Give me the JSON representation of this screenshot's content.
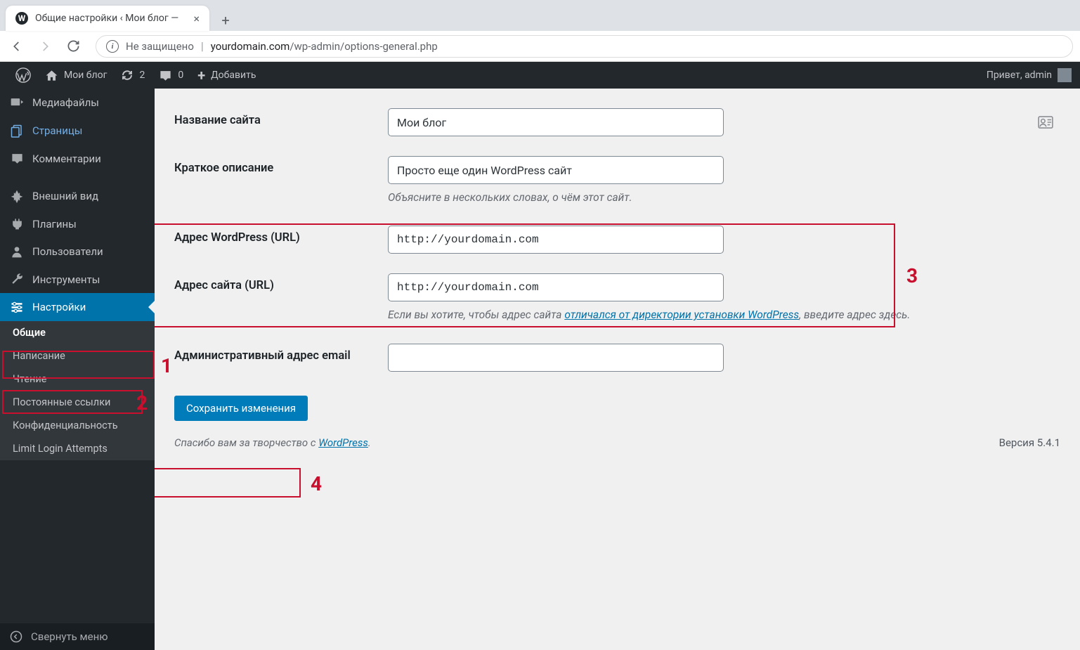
{
  "browser": {
    "tab_title": "Общие настройки ‹ Мои блог —",
    "security_label": "Не защищено",
    "url_host": "yourdomain.com",
    "url_path": "/wp-admin/options-general.php"
  },
  "adminbar": {
    "site_name": "Мои блог",
    "updates_count": "2",
    "comments_count": "0",
    "add_new": "Добавить",
    "howdy": "Привет, admin"
  },
  "sidebar": {
    "media": "Медиафайлы",
    "pages": "Страницы",
    "comments": "Комментарии",
    "appearance": "Внешний вид",
    "plugins": "Плагины",
    "users": "Пользователи",
    "tools": "Инструменты",
    "settings": "Настройки",
    "sub_general": "Общие",
    "sub_writing": "Написание",
    "sub_reading": "Чтение",
    "sub_permalinks": "Постоянные ссылки",
    "sub_privacy": "Конфиденциальность",
    "sub_lla": "Limit Login Attempts",
    "collapse": "Свернуть меню"
  },
  "form": {
    "site_title_label": "Название сайта",
    "site_title_value": "Мои блог",
    "tagline_label": "Краткое описание",
    "tagline_value": "Просто еще один WordPress сайт",
    "tagline_desc": "Объясните в нескольких словах, о чём этот сайт.",
    "wp_url_label": "Адрес WordPress (URL)",
    "wp_url_value": "http://yourdomain.com",
    "site_url_label": "Адрес сайта (URL)",
    "site_url_value": "http://yourdomain.com",
    "site_url_desc_1": "Если вы хотите, чтобы адрес сайта ",
    "site_url_desc_link": "отличался от директории установки WordPress",
    "site_url_desc_2": ", введите адрес здесь.",
    "admin_email_label": "Административный адрес email",
    "admin_email_value": "",
    "submit": "Сохранить изменения"
  },
  "footer": {
    "thanks_1": "Спасибо вам за творчество с ",
    "thanks_link": "WordPress",
    "thanks_2": ".",
    "version": "Версия 5.4.1"
  },
  "annotations": {
    "n1": "1",
    "n2": "2",
    "n3": "3",
    "n4": "4"
  }
}
